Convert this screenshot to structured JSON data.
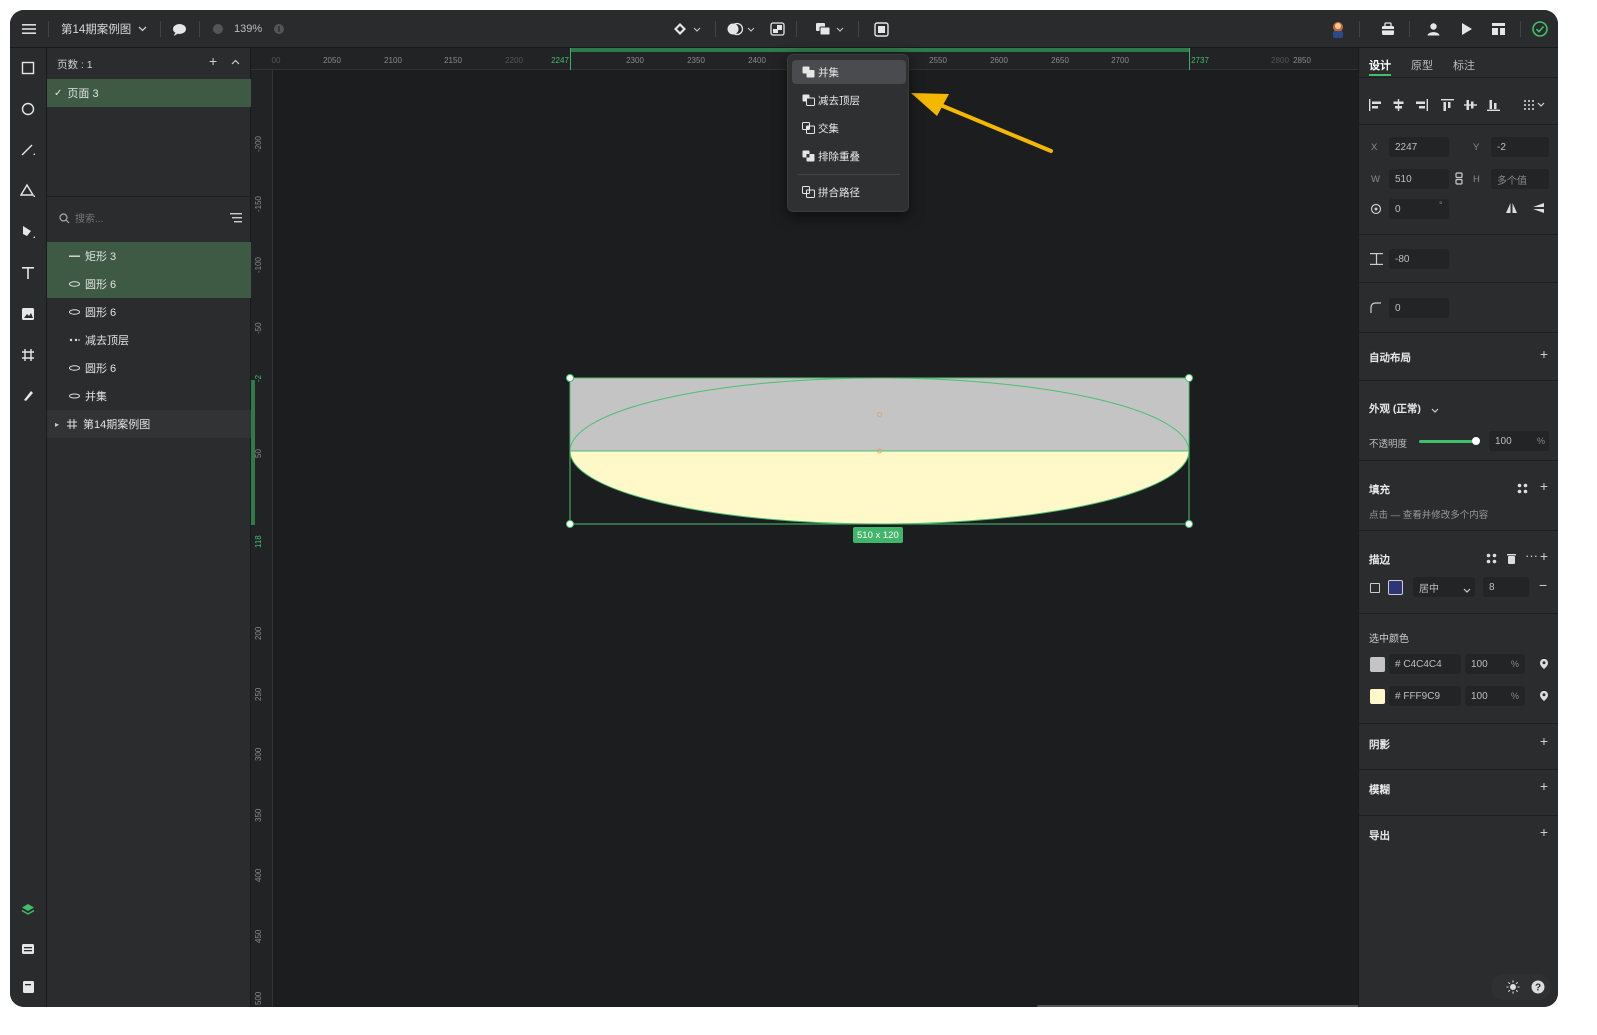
{
  "topbar": {
    "doc_title": "第14期案例图",
    "zoom": "139%"
  },
  "layers": {
    "pages_label": "页数 : 1",
    "page_item": "页面 3",
    "search_placeholder": "搜索...",
    "items": [
      {
        "name": "矩形 3",
        "icon": "rect-line-icon",
        "selected": true
      },
      {
        "name": "圆形 6",
        "icon": "ellipse-icon",
        "selected": true
      },
      {
        "name": "圆形 6",
        "icon": "ellipse-icon",
        "selected": false
      },
      {
        "name": "减去顶层",
        "icon": "subtract-icon",
        "selected": false
      },
      {
        "name": "圆形 6",
        "icon": "ellipse-icon",
        "selected": false
      },
      {
        "name": "并集",
        "icon": "union-icon",
        "selected": false
      },
      {
        "name": "第14期案例图",
        "icon": "frame-icon",
        "selected": false
      }
    ]
  },
  "ruler": {
    "h_ticks": [
      "00",
      "2050",
      "2100",
      "2150",
      "2200",
      "2247",
      "2300",
      "2350",
      "2400",
      "2550",
      "2600",
      "2650",
      "2700",
      "2737",
      "2800",
      "2850"
    ],
    "v_ticks": [
      "-200",
      "-150",
      "-100",
      "-50",
      "-2",
      "50",
      "118",
      "200",
      "250",
      "300",
      "350",
      "400",
      "450",
      "500"
    ]
  },
  "menu": {
    "items": [
      "并集",
      "减去顶层",
      "交集",
      "排除重叠",
      "拼合路径"
    ]
  },
  "canvas": {
    "size_badge": "510 x 120",
    "colors": {
      "top": "#C4C4C4",
      "bottom": "#FFF9C9",
      "stroke": "#4bbf73"
    }
  },
  "right": {
    "tabs": [
      "设计",
      "原型",
      "标注"
    ],
    "x_label": "X",
    "x": "2247",
    "y_label": "Y",
    "y": "-2",
    "w_label": "W",
    "w": "510",
    "h_label": "H",
    "h": "多个值",
    "rotation": "0",
    "spacing": "-80",
    "radius": "0",
    "auto_layout": "自动布局",
    "appearance": "外观 (正常)",
    "opacity_label": "不透明度",
    "opacity": "100",
    "pct": "%",
    "fill": "填充",
    "fill_hint": "点击 — 查看并修改多个内容",
    "stroke": "描边",
    "stroke_align": "居中",
    "stroke_width": "8",
    "selected_colors": "选中颜色",
    "color1": "# C4C4C4",
    "color1_op": "100",
    "color2": "# FFF9C9",
    "color2_op": "100",
    "shadow": "阴影",
    "blur": "模糊",
    "export": "导出"
  }
}
